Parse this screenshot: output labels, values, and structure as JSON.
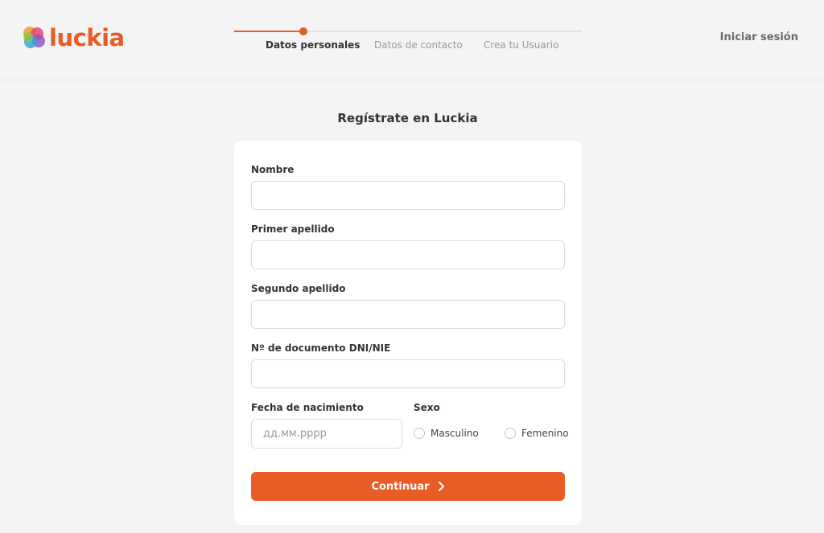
{
  "brand": {
    "name": "luckia",
    "accent": "#e95c25"
  },
  "header": {
    "steps": [
      {
        "label": "Datos personales",
        "state": "active"
      },
      {
        "label": "Datos de contacto",
        "state": "pending"
      },
      {
        "label": "Crea tu Usuario",
        "state": "pending"
      }
    ],
    "login_label": "Iniciar sesión"
  },
  "form": {
    "title": "Regístrate en Luckia",
    "fields": {
      "nombre": {
        "label": "Nombre",
        "value": "",
        "placeholder": ""
      },
      "primer_apellido": {
        "label": "Primer apellido",
        "value": "",
        "placeholder": ""
      },
      "segundo_apellido": {
        "label": "Segundo apellido",
        "value": "",
        "placeholder": ""
      },
      "documento": {
        "label": "Nº de documento DNI/NIE",
        "value": "",
        "placeholder": ""
      },
      "fecha": {
        "label": "Fecha de nacimiento",
        "value": "",
        "placeholder": "дд.мм.рррр"
      }
    },
    "sexo": {
      "label": "Sexo",
      "options": [
        "Masculino",
        "Femenino"
      ],
      "selected": ""
    },
    "submit_label": "Continuar"
  }
}
